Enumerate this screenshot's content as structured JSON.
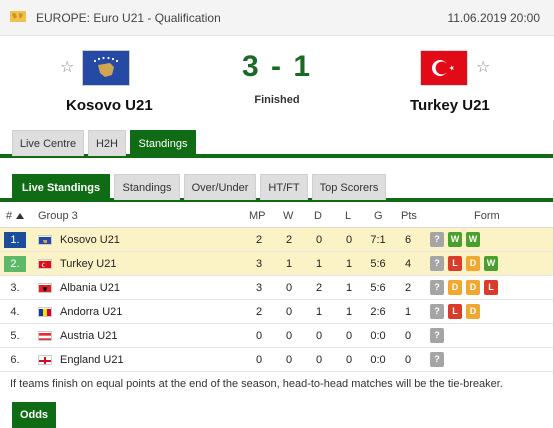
{
  "header": {
    "tournament": "EUROPE: Euro U21 - Qualification",
    "datetime": "11.06.2019 20:00"
  },
  "match": {
    "home_team": "Kosovo U21",
    "away_team": "Turkey U21",
    "score": "3 - 1",
    "status": "Finished"
  },
  "main_tabs": [
    "Live Centre",
    "H2H",
    "Standings"
  ],
  "main_tabs_active": "Standings",
  "standings_tabs": [
    "Live Standings",
    "Standings",
    "Over/Under",
    "HT/FT",
    "Top Scorers"
  ],
  "standings_tabs_active": "Live Standings",
  "table": {
    "headers": {
      "rank": "#",
      "group": "Group 3",
      "mp": "MP",
      "w": "W",
      "d": "D",
      "l": "L",
      "g": "G",
      "pts": "Pts",
      "form": "Form"
    },
    "rows": [
      {
        "rank": "1.",
        "team": "Kosovo U21",
        "mp": "2",
        "w": "2",
        "d": "0",
        "l": "0",
        "g": "7:1",
        "pts": "6",
        "form": [
          "?",
          "W",
          "W"
        ]
      },
      {
        "rank": "2.",
        "team": "Turkey U21",
        "mp": "3",
        "w": "1",
        "d": "1",
        "l": "1",
        "g": "5:6",
        "pts": "4",
        "form": [
          "?",
          "L",
          "D",
          "W"
        ]
      },
      {
        "rank": "3.",
        "team": "Albania U21",
        "mp": "3",
        "w": "0",
        "d": "2",
        "l": "1",
        "g": "5:6",
        "pts": "2",
        "form": [
          "?",
          "D",
          "D",
          "L"
        ]
      },
      {
        "rank": "4.",
        "team": "Andorra U21",
        "mp": "2",
        "w": "0",
        "d": "1",
        "l": "1",
        "g": "2:6",
        "pts": "1",
        "form": [
          "?",
          "L",
          "D"
        ]
      },
      {
        "rank": "5.",
        "team": "Austria U21",
        "mp": "0",
        "w": "0",
        "d": "0",
        "l": "0",
        "g": "0:0",
        "pts": "0",
        "form": [
          "?"
        ]
      },
      {
        "rank": "6.",
        "team": "England U21",
        "mp": "0",
        "w": "0",
        "d": "0",
        "l": "0",
        "g": "0:0",
        "pts": "0",
        "form": [
          "?"
        ]
      }
    ]
  },
  "note": "If teams finish on equal points at the end of the season, head-to-head matches will be the tie-breaker.",
  "odds_label": "Odds",
  "colors": {
    "accent_green": "#0f6c14",
    "score_green": "#1b6a24",
    "highlight_row": "#fbf3c6",
    "rank_1": "#1a4e9a",
    "rank_2": "#5db86a",
    "form_win": "#4aa02c",
    "form_loss": "#dc3b2a",
    "form_draw": "#f0a830",
    "form_unknown": "#a5a5a5"
  },
  "icons": {
    "tournament": "globe-icon",
    "favorite": "star-outline-icon",
    "sort": "sort-up-icon"
  }
}
